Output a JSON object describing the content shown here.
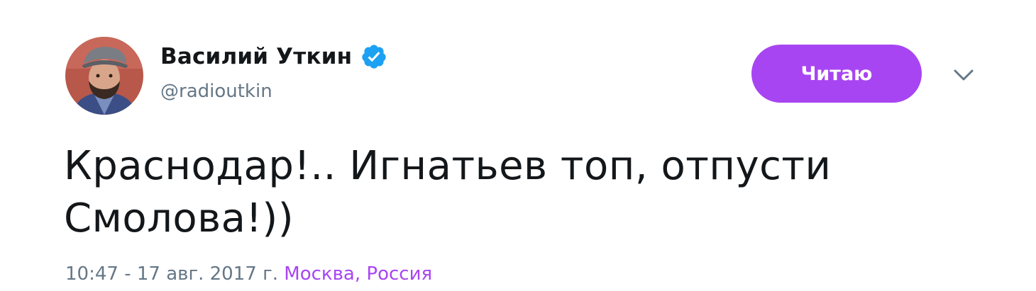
{
  "user": {
    "name": "Василий Уткин",
    "handle": "@radioutkin",
    "verified": true,
    "avatar": "user-photo"
  },
  "follow_button": {
    "label": "Читаю",
    "color": "#a845f2"
  },
  "menu": {
    "icon": "chevron-down-icon"
  },
  "tweet": {
    "text_line1": "Краснодар!.. Игнатьев топ, отпусти",
    "text_line2": "Смолова!))",
    "timestamp": "10:47 - 17 авг. 2017 г.",
    "location": "Москва, Россия"
  },
  "colors": {
    "accent": "#a845f2",
    "verified_badge": "#1da1f2",
    "secondary_text": "#657786",
    "primary_text": "#14171a"
  }
}
